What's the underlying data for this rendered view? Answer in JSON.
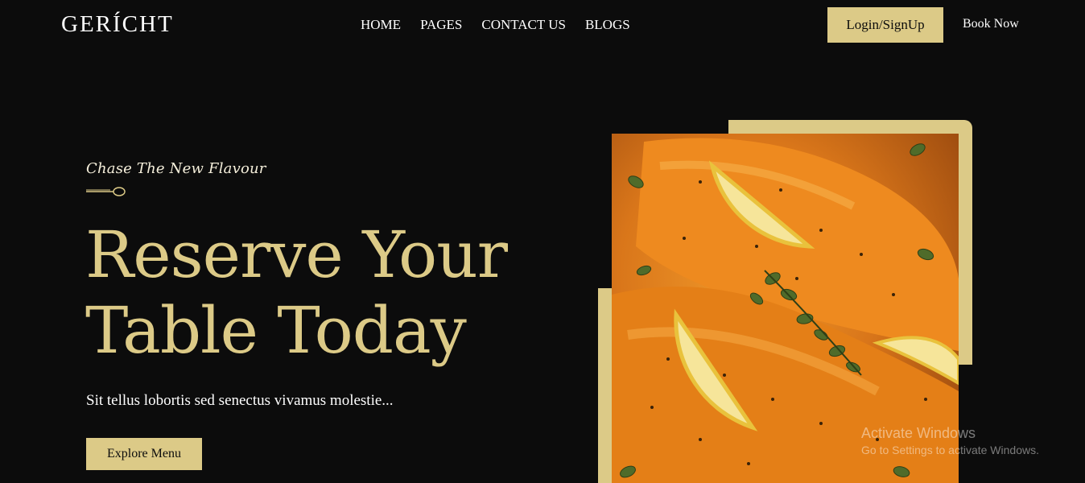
{
  "brand": {
    "logo": "GERÍCHT"
  },
  "nav": {
    "items": [
      {
        "label": "HOME"
      },
      {
        "label": "PAGES"
      },
      {
        "label": "CONTACT US"
      },
      {
        "label": "BLOGS"
      }
    ],
    "login_label": "Login/SignUp",
    "book_label": "Book Now"
  },
  "hero": {
    "subtitle": "Chase The New Flavour",
    "headline_line1": "Reserve Your",
    "headline_line2": "Table Today",
    "description": "Sit tellus lobortis sed senectus vivamus molestie...",
    "cta_label": "Explore Menu"
  },
  "watermark": {
    "title": "Activate Windows",
    "subtitle": "Go to Settings to activate Windows."
  },
  "colors": {
    "background": "#0c0c0c",
    "accent_gold": "#dcca87",
    "text_white": "#ffffff"
  },
  "icons": {
    "spoon": "spoon-icon"
  }
}
